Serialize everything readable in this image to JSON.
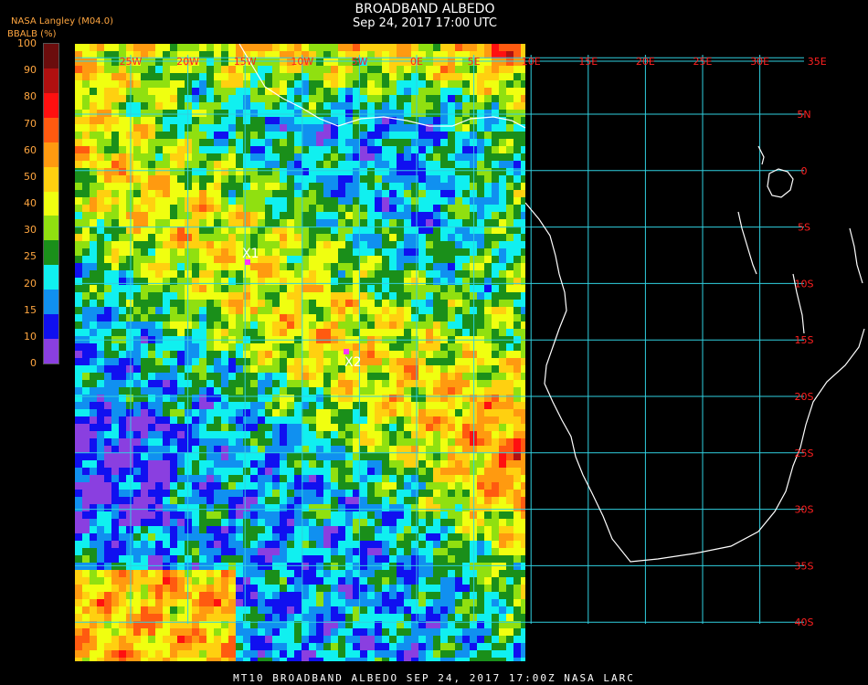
{
  "header": {
    "title": "BROADBAND ALBEDO",
    "subtitle": "Sep 24, 2017 17:00 UTC",
    "source": "NASA Langley (M04.0)",
    "variable": "BBALB (%)"
  },
  "colorbar": {
    "ticks": [
      "100",
      "90",
      "80",
      "70",
      "60",
      "50",
      "40",
      "30",
      "25",
      "20",
      "15",
      "10",
      "0"
    ],
    "colors": [
      "#6b0d0d",
      "#b01010",
      "#ff1010",
      "#ff5a10",
      "#ff9a10",
      "#ffd010",
      "#f0ff10",
      "#90e010",
      "#1a8f1a",
      "#10f0f0",
      "#1090f0",
      "#1010f0",
      "#8a3fe0"
    ]
  },
  "map": {
    "lon_labels": [
      "25W",
      "20W",
      "15W",
      "10W",
      "5W",
      "0E",
      "5E",
      "10E",
      "15E",
      "20E",
      "25E",
      "30E",
      "35E"
    ],
    "lat_labels": [
      "5N",
      "0",
      "5S",
      "10S",
      "15S",
      "20S",
      "25S",
      "30S",
      "35S",
      "40S"
    ],
    "markers": [
      {
        "label": "X1",
        "color": "#ff30ff"
      },
      {
        "label": "X2",
        "color": "#ff30ff"
      }
    ],
    "colors": {
      "grid": "#30d0e0",
      "coast": "#ffffff",
      "latlon_label": "#ff2020"
    }
  },
  "footer": {
    "text": "MT10  BROADBAND ALBEDO   SEP 24, 2017 17:00Z   NASA LARC"
  }
}
